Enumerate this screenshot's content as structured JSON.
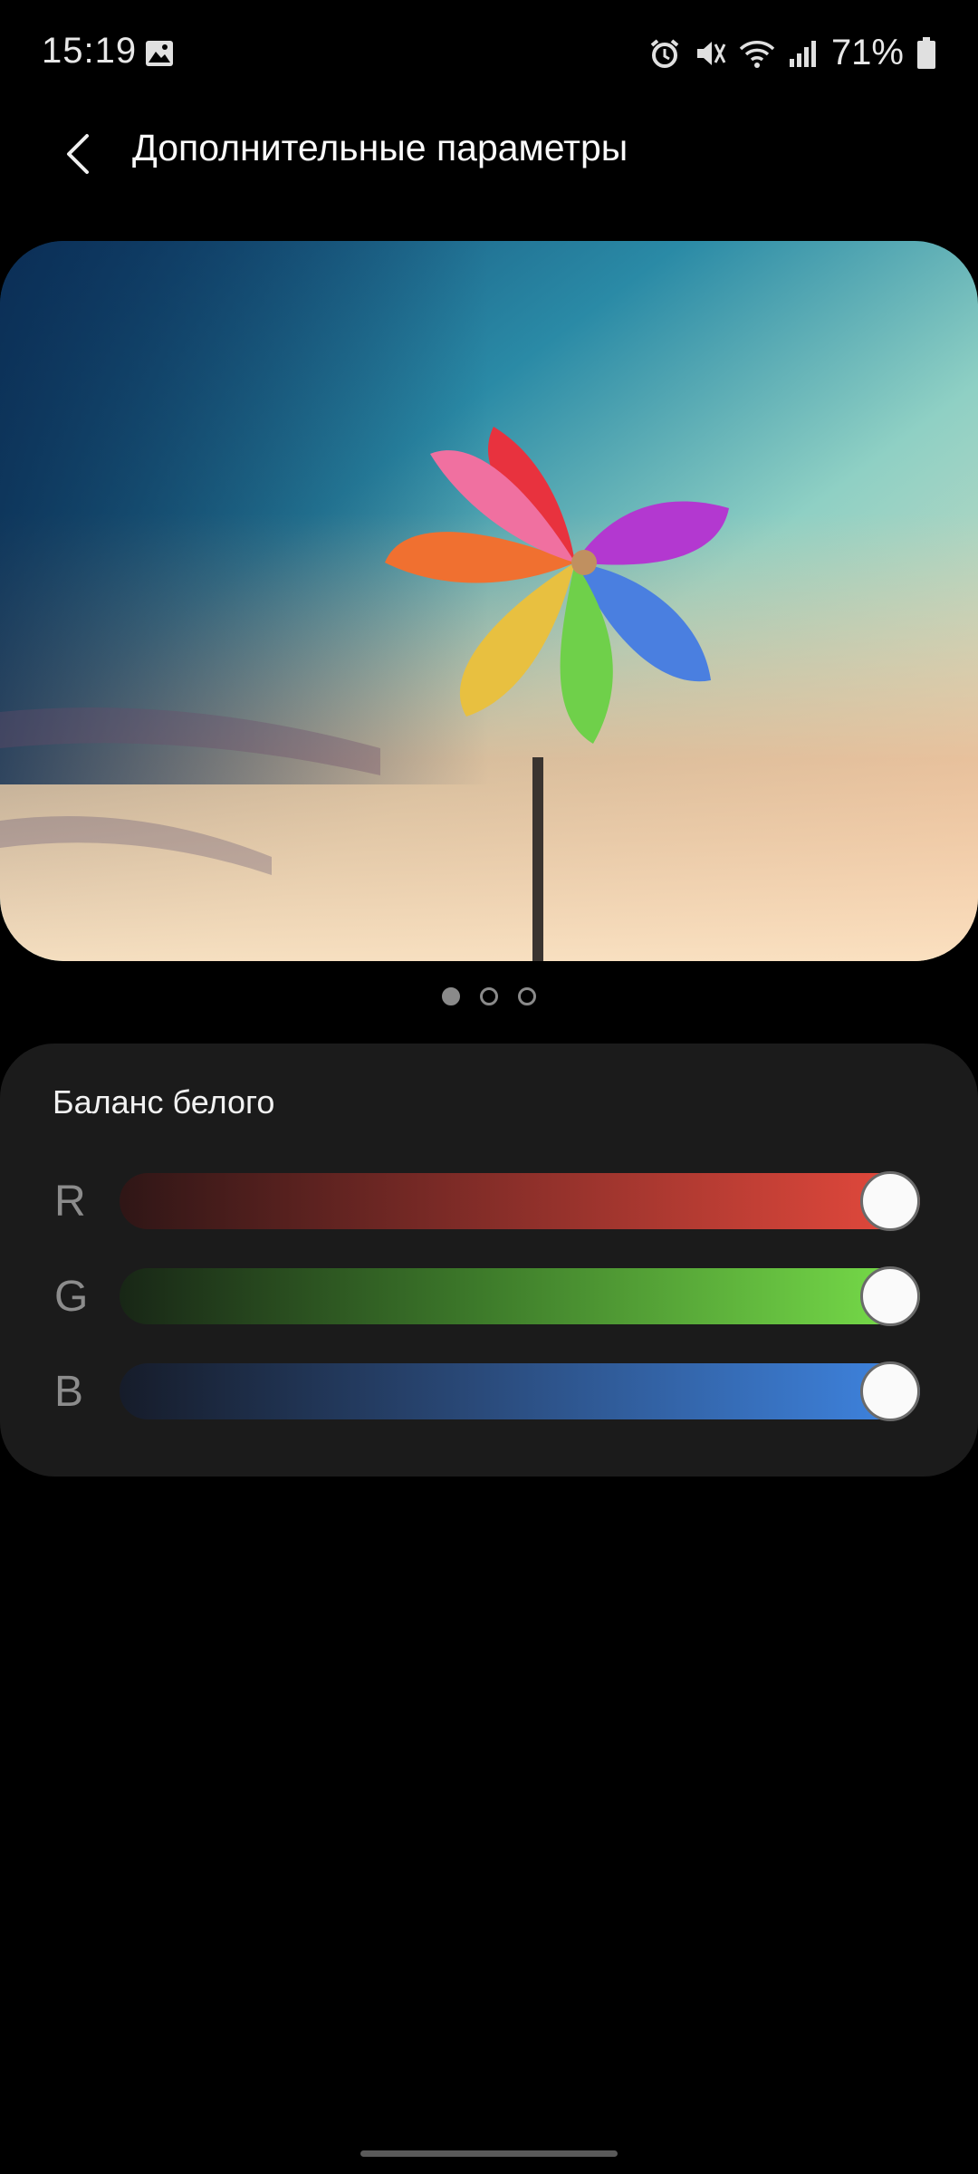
{
  "status_bar": {
    "time": "15:19",
    "battery_percent": "71%",
    "icons": [
      "gallery-icon",
      "alarm-icon",
      "mute-icon",
      "wifi-icon",
      "signal-icon",
      "battery-icon"
    ]
  },
  "header": {
    "title": "Дополнительные параметры",
    "back_icon": "chevron-left-icon"
  },
  "preview": {
    "image": "pinwheel-photo",
    "page_count": 3,
    "active_page": 1
  },
  "white_balance": {
    "title": "Баланс белого",
    "channels": [
      {
        "label": "R",
        "value": 1.0,
        "color": "#e74a3d"
      },
      {
        "label": "G",
        "value": 1.0,
        "color": "#79e04a"
      },
      {
        "label": "B",
        "value": 1.0,
        "color": "#3f86e4"
      }
    ]
  }
}
